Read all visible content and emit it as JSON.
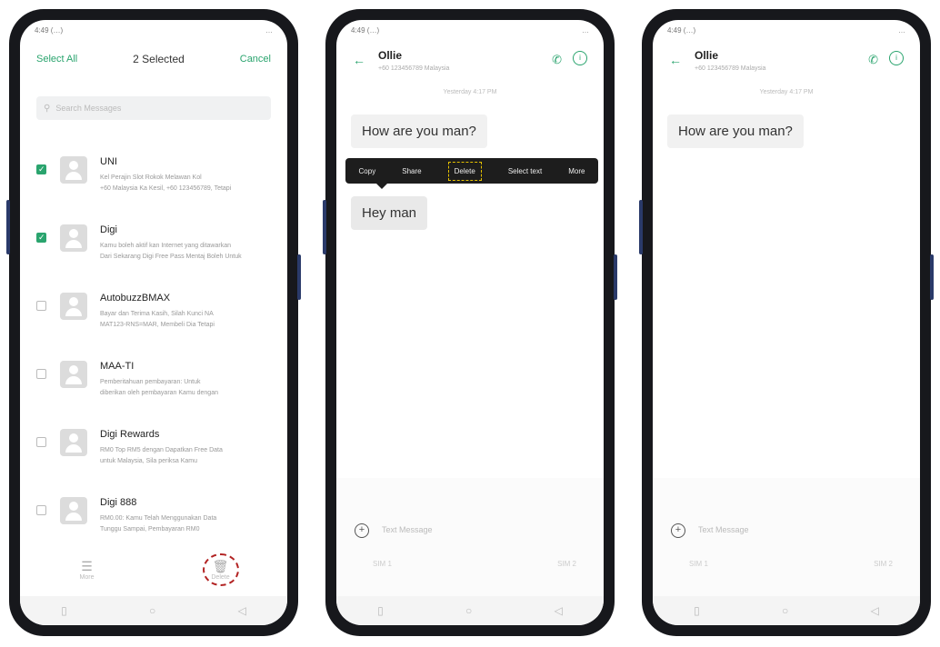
{
  "status": {
    "left": "4:49 (…)",
    "right": "…"
  },
  "phone1": {
    "select_all": "Select All",
    "title": "2 Selected",
    "cancel": "Cancel",
    "search_placeholder": "Search Messages",
    "conversations": [
      {
        "name": "UNI",
        "date": "",
        "selected": true,
        "line1": "Kel Perajin Slot Rokok Melawan Kol",
        "line2": "+60 Malaysia Ka Kesil, +60 123456789, Tetapi"
      },
      {
        "name": "Digi",
        "date": "",
        "selected": true,
        "line1": "Kamu boleh aktif kan Internet yang ditawarkan",
        "line2": "Dari Sekarang Digi Free Pass Mentaj Boleh Untuk"
      },
      {
        "name": "AutobuzzBMAX",
        "date": "",
        "selected": false,
        "line1": "Bayar dan Terima Kasih, Silah Kunci NA",
        "line2": "MAT123-RNS=MAR, Membeli Dia Tetapi"
      },
      {
        "name": "MAA-TI",
        "date": "",
        "selected": false,
        "line1": "Pemberitahuan pembayaran: Untuk",
        "line2": "diberikan oleh pembayaran Kamu dengan"
      },
      {
        "name": "Digi Rewards",
        "date": "",
        "selected": false,
        "line1": "RM0 Top RM5 dengan Dapatkan Free Data",
        "line2": "untuk Malaysia, Sila periksa Kamu"
      },
      {
        "name": "Digi 888",
        "date": "",
        "selected": false,
        "line1": "RM0.00: Kamu Telah Menggunakan Data",
        "line2": "Tunggu Sampai, Pembayaran RM0"
      }
    ],
    "bottom_left_label": "More",
    "bottom_right_label": "Delete"
  },
  "chat": {
    "name": "Ollie",
    "number": "+60 123456789 Malaysia",
    "date_sep": "Yesterday 4:17 PM",
    "msg1": "How are you man?",
    "msg2": "Hey man",
    "menu": [
      "Copy",
      "Share",
      "Delete",
      "Select text",
      "More"
    ],
    "input_placeholder": "Text Message",
    "sim1": "SIM 1",
    "sim2": "SIM 2"
  }
}
